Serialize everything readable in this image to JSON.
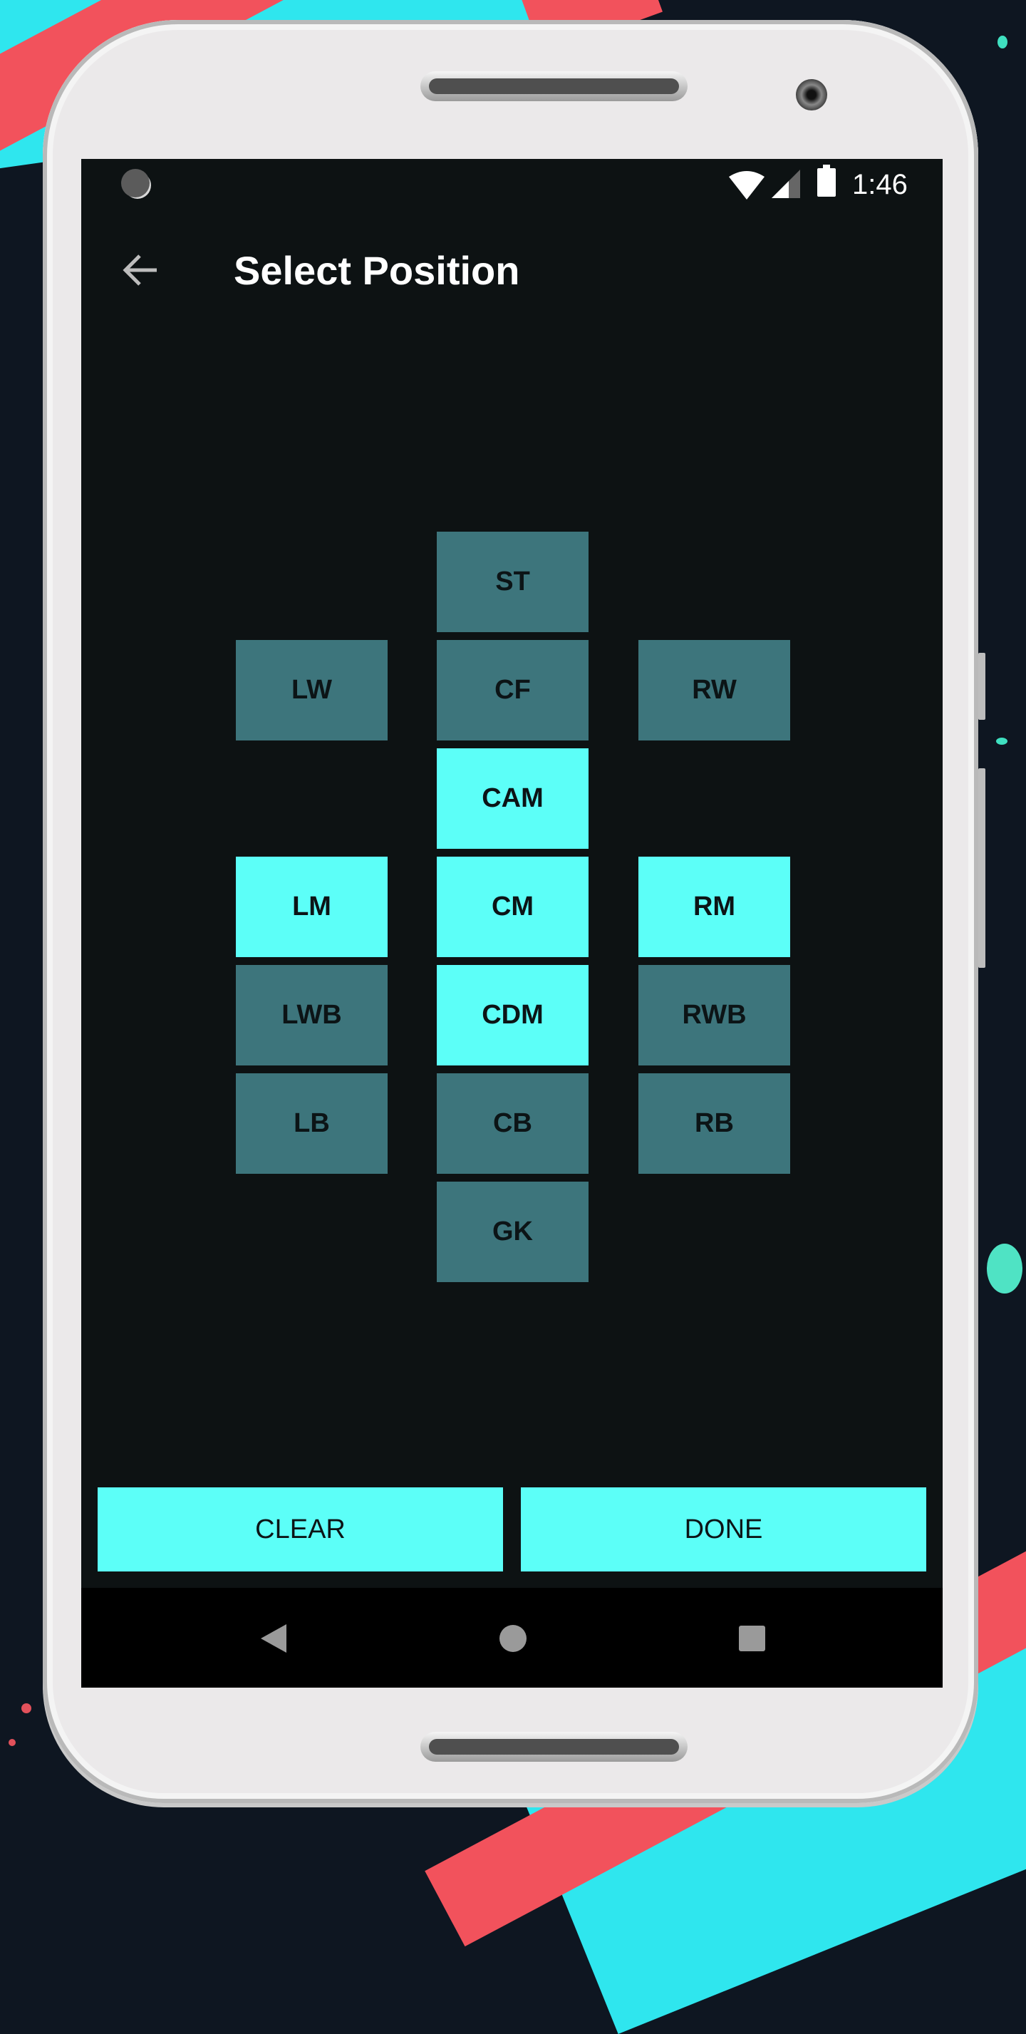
{
  "status_bar": {
    "time": "1:46",
    "icons": [
      "sync-icon",
      "wifi-icon",
      "signal-icon",
      "battery-icon"
    ]
  },
  "app_bar": {
    "title": "Select Position",
    "back_icon": "arrow-left-icon"
  },
  "positions": [
    {
      "label": "ST",
      "selected": false
    },
    {
      "label": "LW",
      "selected": false
    },
    {
      "label": "CF",
      "selected": false
    },
    {
      "label": "RW",
      "selected": false
    },
    {
      "label": "CAM",
      "selected": true
    },
    {
      "label": "LM",
      "selected": true
    },
    {
      "label": "CM",
      "selected": true
    },
    {
      "label": "RM",
      "selected": true
    },
    {
      "label": "LWB",
      "selected": false
    },
    {
      "label": "CDM",
      "selected": true
    },
    {
      "label": "RWB",
      "selected": false
    },
    {
      "label": "LB",
      "selected": false
    },
    {
      "label": "CB",
      "selected": false
    },
    {
      "label": "RB",
      "selected": false
    },
    {
      "label": "GK",
      "selected": false
    }
  ],
  "actions": {
    "clear_label": "CLEAR",
    "done_label": "DONE"
  },
  "colors": {
    "selected": "#5cfff8",
    "unselected": "#3d757c",
    "background": "#0d1213"
  },
  "nav_bar": {
    "icons": [
      "nav-back-icon",
      "nav-home-icon",
      "nav-recents-icon"
    ]
  }
}
